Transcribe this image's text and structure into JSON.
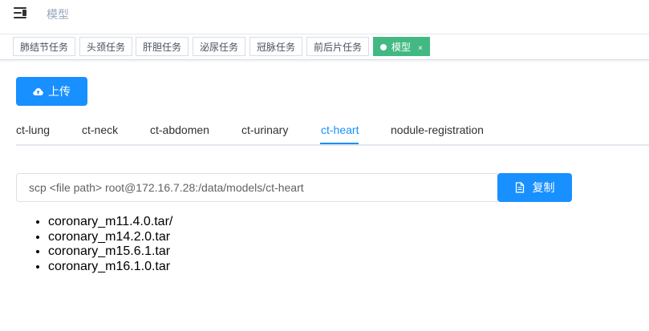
{
  "header": {
    "breadcrumb": "模型"
  },
  "tags": [
    {
      "label": "肺结节任务",
      "active": false
    },
    {
      "label": "头颈任务",
      "active": false
    },
    {
      "label": "肝胆任务",
      "active": false
    },
    {
      "label": "泌尿任务",
      "active": false
    },
    {
      "label": "冠脉任务",
      "active": false
    },
    {
      "label": "前后片任务",
      "active": false
    },
    {
      "label": "模型",
      "active": true,
      "close": "×"
    }
  ],
  "upload": {
    "label": "上传",
    "icon": "cloud-upload-icon"
  },
  "tabs": [
    {
      "label": "ct-lung"
    },
    {
      "label": "ct-neck"
    },
    {
      "label": "ct-abdomen"
    },
    {
      "label": "ct-urinary"
    },
    {
      "label": "ct-heart",
      "active": true
    },
    {
      "label": "nodule-registration"
    }
  ],
  "command": {
    "value": "scp <file path> root@172.16.7.28:/data/models/ct-heart"
  },
  "copy": {
    "label": "复制",
    "icon": "document-icon"
  },
  "files": [
    "coronary_m11.4.0.tar/",
    "coronary_m14.2.0.tar",
    "coronary_m15.6.1.tar",
    "coronary_m16.1.0.tar"
  ],
  "colors": {
    "primary": "#1890ff",
    "active_tag": "#42b983",
    "breadcrumb": "#97a8be"
  }
}
